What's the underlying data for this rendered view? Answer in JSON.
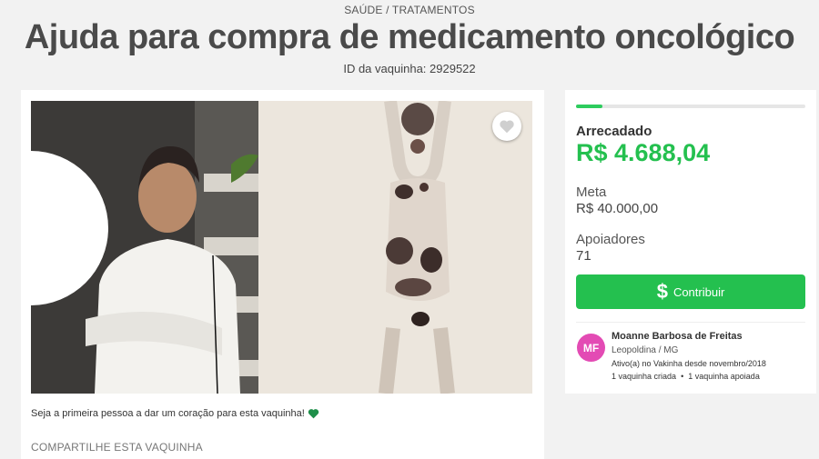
{
  "header": {
    "category": "SAÚDE / TRATAMENTOS",
    "title": "Ajuda para compra de medicamento oncológico",
    "campaign_id": "ID da vaquinha: 2929522"
  },
  "main": {
    "heart_cta": "Seja a primeira pessoa a dar um coração para esta vaquinha!",
    "share_label": "COMPARTILHE ESTA VAQUINHA"
  },
  "sidebar": {
    "progress_fraction": 0.117,
    "raised_label": "Arrecadado",
    "raised_value": "R$ 4.688,04",
    "goal_label": "Meta",
    "goal_value": "R$ 40.000,00",
    "backers_label": "Apoiadores",
    "backers_value": "71",
    "contribute_label": "Contribuir",
    "creator": {
      "initials": "MF",
      "name": "Moanne Barbosa de Freitas",
      "location": "Leopoldina / MG",
      "since": "Ativo(a) no Vakinha desde novembro/2018",
      "campaigns_created": "1 vaquinha criada",
      "campaigns_supported": "1 vaquinha apoiada"
    }
  },
  "colors": {
    "accent_green": "#24c04f",
    "avatar_pink": "#e34bb4",
    "heart_green": "#1f8f4a"
  },
  "icons": {
    "favorite": "heart-outline-icon",
    "heart_emoji": "green-heart-icon",
    "contribute": "dollar-icon"
  }
}
